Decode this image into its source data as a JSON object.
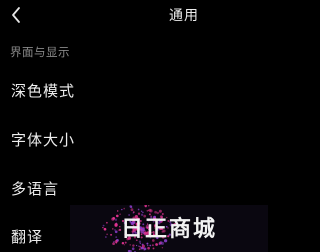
{
  "header": {
    "title": "通用",
    "back_icon": "chevron-left-icon"
  },
  "section": {
    "title": "界面与显示"
  },
  "menu": {
    "items": [
      {
        "label": "深色模式"
      },
      {
        "label": "字体大小"
      },
      {
        "label": "多语言"
      },
      {
        "label": "翻译"
      }
    ]
  },
  "watermark": {
    "text": "日正商城"
  },
  "colors": {
    "background": "#000000",
    "text": "#ededed",
    "section_text": "#8a8a8a",
    "watermark_bg": "#0a0710",
    "watermark_dots_primary": "#e0338f",
    "watermark_dots_secondary": "#8a3ec9"
  }
}
